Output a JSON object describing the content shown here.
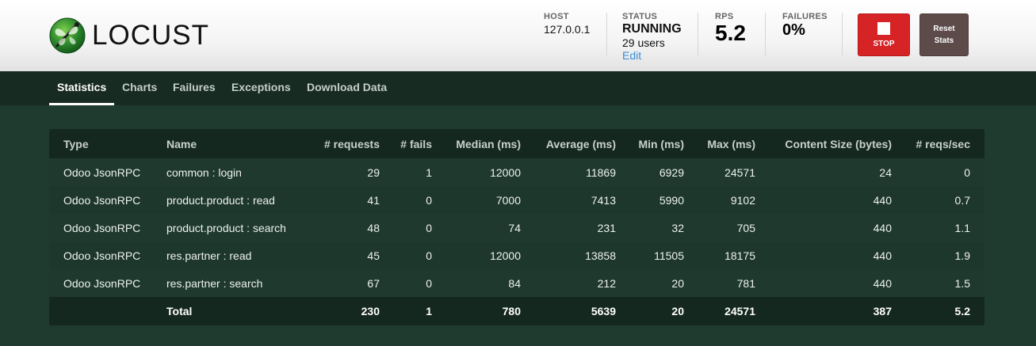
{
  "brand": {
    "name": "LOCUST"
  },
  "header": {
    "host": {
      "label": "HOST",
      "value": "127.0.0.1"
    },
    "status": {
      "label": "STATUS",
      "value": "RUNNING",
      "users": "29 users",
      "edit": "Edit"
    },
    "rps": {
      "label": "RPS",
      "value": "5.2"
    },
    "failures": {
      "label": "FAILURES",
      "value": "0%"
    },
    "stop_label": "STOP",
    "reset_label_1": "Reset",
    "reset_label_2": "Stats"
  },
  "colors": {
    "stop_button": "#d62326",
    "reset_button": "#5d4b4a",
    "background": "#1f3a2e",
    "link": "#3b8ed6"
  },
  "icons": {
    "logo": "locust-dragonfly-logo-icon",
    "stop": "stop-square-icon"
  },
  "tabs": [
    {
      "label": "Statistics",
      "active": true
    },
    {
      "label": "Charts"
    },
    {
      "label": "Failures"
    },
    {
      "label": "Exceptions"
    },
    {
      "label": "Download Data"
    }
  ],
  "table": {
    "headers": [
      "Type",
      "Name",
      "# requests",
      "# fails",
      "Median (ms)",
      "Average (ms)",
      "Min (ms)",
      "Max (ms)",
      "Content Size (bytes)",
      "# reqs/sec"
    ],
    "rows": [
      [
        "Odoo JsonRPC",
        "common : login",
        "29",
        "1",
        "12000",
        "11869",
        "6929",
        "24571",
        "24",
        "0"
      ],
      [
        "Odoo JsonRPC",
        "product.product : read",
        "41",
        "0",
        "7000",
        "7413",
        "5990",
        "9102",
        "440",
        "0.7"
      ],
      [
        "Odoo JsonRPC",
        "product.product : search",
        "48",
        "0",
        "74",
        "231",
        "32",
        "705",
        "440",
        "1.1"
      ],
      [
        "Odoo JsonRPC",
        "res.partner : read",
        "45",
        "0",
        "12000",
        "13858",
        "11505",
        "18175",
        "440",
        "1.9"
      ],
      [
        "Odoo JsonRPC",
        "res.partner : search",
        "67",
        "0",
        "84",
        "212",
        "20",
        "781",
        "440",
        "1.5"
      ]
    ],
    "total": [
      "",
      "Total",
      "230",
      "1",
      "780",
      "5639",
      "20",
      "24571",
      "387",
      "5.2"
    ]
  }
}
